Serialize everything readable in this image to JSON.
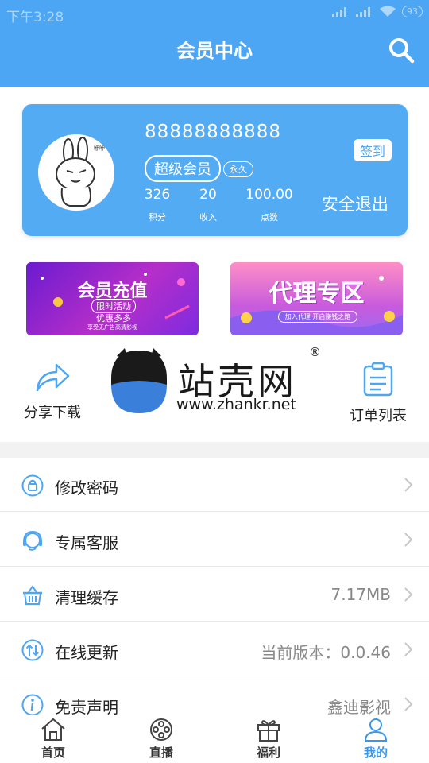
{
  "status_bar": {
    "time": "下午3:28",
    "battery": "93"
  },
  "header": {
    "title": "会员中心"
  },
  "profile": {
    "user_id": "88888888888",
    "vip_label": "超级会员",
    "duration_label": "永久",
    "checkin_label": "签到",
    "logout_label": "安全退出",
    "stats": [
      {
        "value": "326",
        "label": "积分"
      },
      {
        "value": "20",
        "label": "收入"
      },
      {
        "value": "100.00",
        "label": "点数"
      }
    ]
  },
  "banners": {
    "left": {
      "title": "会员充值",
      "tag": "限时活动",
      "sub": "优惠多多",
      "footer": "享受无广告高清影视"
    },
    "right": {
      "title": "代理专区",
      "sub": "加入代理 开启赚钱之路"
    }
  },
  "quick_actions": {
    "share": "分享下载",
    "orders": "订单列表"
  },
  "watermark": {
    "brand": "站壳网",
    "url": "www.zhankr.net",
    "mark": "®"
  },
  "menu": [
    {
      "label": "修改密码",
      "value": ""
    },
    {
      "label": "专属客服",
      "value": ""
    },
    {
      "label": "清理缓存",
      "value": "7.17MB"
    },
    {
      "label": "在线更新",
      "value": "当前版本：0.0.46"
    },
    {
      "label": "免责声明",
      "value": "鑫迪影视"
    }
  ],
  "tabbar": [
    {
      "label": "首页"
    },
    {
      "label": "直播"
    },
    {
      "label": "福利"
    },
    {
      "label": "我的"
    }
  ],
  "colors": {
    "primary": "#4da6f3",
    "active_tab": "#3a96e8"
  }
}
